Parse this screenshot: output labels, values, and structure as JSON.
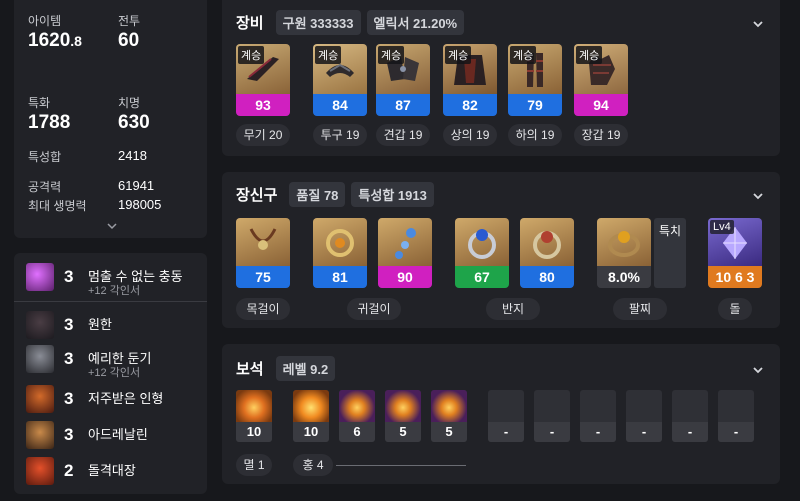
{
  "stats": {
    "item_level": {
      "label": "아이템",
      "value": "1620",
      "decimal": ".8"
    },
    "combat": {
      "label": "전투",
      "value": "60"
    },
    "crit_label": "특화",
    "crit_value": "1788",
    "swift_label": "치명",
    "swift_value": "630",
    "trait_sum_label": "특성합",
    "trait_sum_value": "2418",
    "attack_label": "공격력",
    "attack_value": "61941",
    "hp_label": "최대 생명력",
    "hp_value": "198005"
  },
  "engravings": [
    {
      "count": "3",
      "name": "멈출 수 없는 충동",
      "sub": "+12 각인서",
      "color": "#7d2d8a"
    },
    {
      "count": "3",
      "name": "원한",
      "sub": "",
      "color": "#5a2a2a"
    },
    {
      "count": "3",
      "name": "예리한 둔기",
      "sub": "+12 각인서",
      "color": "#4b4d55"
    },
    {
      "count": "3",
      "name": "저주받은 인형",
      "sub": "",
      "color": "#8a3a1f"
    },
    {
      "count": "3",
      "name": "아드레날린",
      "sub": "",
      "color": "#7a5a35"
    },
    {
      "count": "2",
      "name": "돌격대장",
      "sub": "",
      "color": "#9a3b20"
    }
  ],
  "equipment": {
    "title": "장비",
    "badge1": "구원 333333",
    "badge2": "엘릭서 21.20%",
    "items": [
      {
        "tag": "계승",
        "quality": "93",
        "color": "#d020c0",
        "label": "무기 20"
      },
      {
        "tag": "계승",
        "quality": "84",
        "color": "#1f6fe0",
        "label": "투구 19"
      },
      {
        "tag": "계승",
        "quality": "87",
        "color": "#1f6fe0",
        "label": "견갑 19"
      },
      {
        "tag": "계승",
        "quality": "82",
        "color": "#1f6fe0",
        "label": "상의 19"
      },
      {
        "tag": "계승",
        "quality": "79",
        "color": "#1f6fe0",
        "label": "하의 19"
      },
      {
        "tag": "계승",
        "quality": "94",
        "color": "#d020c0",
        "label": "장갑 19"
      }
    ]
  },
  "accessories": {
    "title": "장신구",
    "badge1": "품질 78",
    "badge2": "특성합 1913",
    "items": [
      {
        "value": "75",
        "color": "#1f6fe0"
      },
      {
        "value": "81",
        "color": "#1f6fe0"
      },
      {
        "value": "90",
        "color": "#d020c0"
      },
      {
        "value": "67",
        "color": "#1ea44a"
      },
      {
        "value": "80",
        "color": "#1f6fe0"
      },
      {
        "value": "8.0%",
        "color": "#3a3b41"
      },
      {
        "value": "10 6 3",
        "color": "#e07a1f"
      }
    ],
    "special_label": "특치",
    "stone_level": "Lv4",
    "labels": {
      "necklace": "목걸이",
      "earring": "귀걸이",
      "ring": "반지",
      "bracelet": "팔찌",
      "stone": "돌"
    }
  },
  "gems": {
    "title": "보석",
    "badge": "레벨 9.2",
    "levels": [
      "10",
      "10",
      "6",
      "5",
      "5"
    ],
    "empty": [
      "-",
      "-",
      "-",
      "-",
      "-",
      "-"
    ],
    "summary_left": "멸 1",
    "summary_right": "홍 4"
  }
}
